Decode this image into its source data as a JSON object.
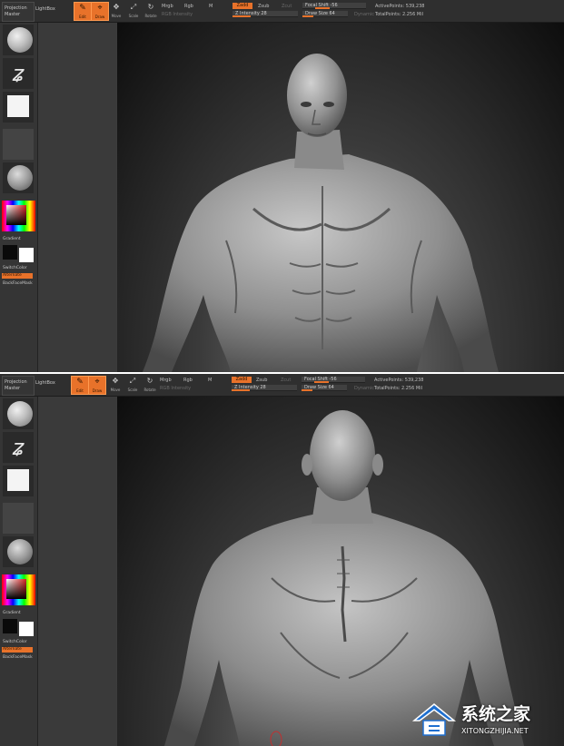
{
  "top_panel": {
    "toolbar": {
      "projection_master_line1": "Projection",
      "projection_master_line2": "Master",
      "lightbox": "LightBox",
      "tools": [
        {
          "label": "Edit",
          "glyph": "✎"
        },
        {
          "label": "Draw",
          "glyph": "⌖"
        },
        {
          "label": "Move",
          "glyph": "✥"
        },
        {
          "label": "Scale",
          "glyph": "⤢"
        },
        {
          "label": "Rotate",
          "glyph": "↻"
        }
      ],
      "mrgb": "Mrgb",
      "rgb": "Rgb",
      "m": "M",
      "rgb_intensity": "RGB Intensity",
      "zadd": "Zadd",
      "zsub": "Zsub",
      "zcut": "Zcut",
      "z_intensity": "Z Intensity 28",
      "focal_shift": "Focal Shift -56",
      "draw_size": "Draw Size 64",
      "dynamic": "Dynamic",
      "active_points": "ActivePoints: 539,238",
      "total_points": "TotalPoints: 2.256 Mil"
    },
    "shelf": {
      "gradient": "Gradient",
      "switch_color": "SwitchColor",
      "alternate": "Alternate",
      "backface_mask": "BackFaceMask"
    },
    "view": "front torso sculpt"
  },
  "bottom_panel": {
    "toolbar": {
      "projection_master_line1": "Projection",
      "projection_master_line2": "Master",
      "lightbox": "LightBox",
      "tools": [
        {
          "label": "Edit",
          "glyph": "✎"
        },
        {
          "label": "Draw",
          "glyph": "⌖"
        },
        {
          "label": "Move",
          "glyph": "✥"
        },
        {
          "label": "Scale",
          "glyph": "⤢"
        },
        {
          "label": "Rotate",
          "glyph": "↻"
        }
      ],
      "mrgb": "Mrgb",
      "rgb": "Rgb",
      "m": "M",
      "rgb_intensity": "RGB Intensity",
      "zadd": "Zadd",
      "zsub": "Zsub",
      "zcut": "Zcut",
      "z_intensity": "Z Intensity 28",
      "focal_shift": "Focal Shift -56",
      "draw_size": "Draw Size 64",
      "dynamic": "Dynamic",
      "active_points": "ActivePoints: 539,238",
      "total_points": "TotalPoints: 2.256 Mil"
    },
    "shelf": {
      "gradient": "Gradient",
      "switch_color": "SwitchColor",
      "alternate": "Alternate",
      "backface_mask": "BackFaceMask"
    }
  },
  "watermark": {
    "brand": "系统之家",
    "url": "XITONGZHIJIA.NET"
  },
  "colors": {
    "accent_orange": "#e8722a",
    "ui_dark": "#2f2f2f",
    "clay": "#9a9a9a"
  }
}
